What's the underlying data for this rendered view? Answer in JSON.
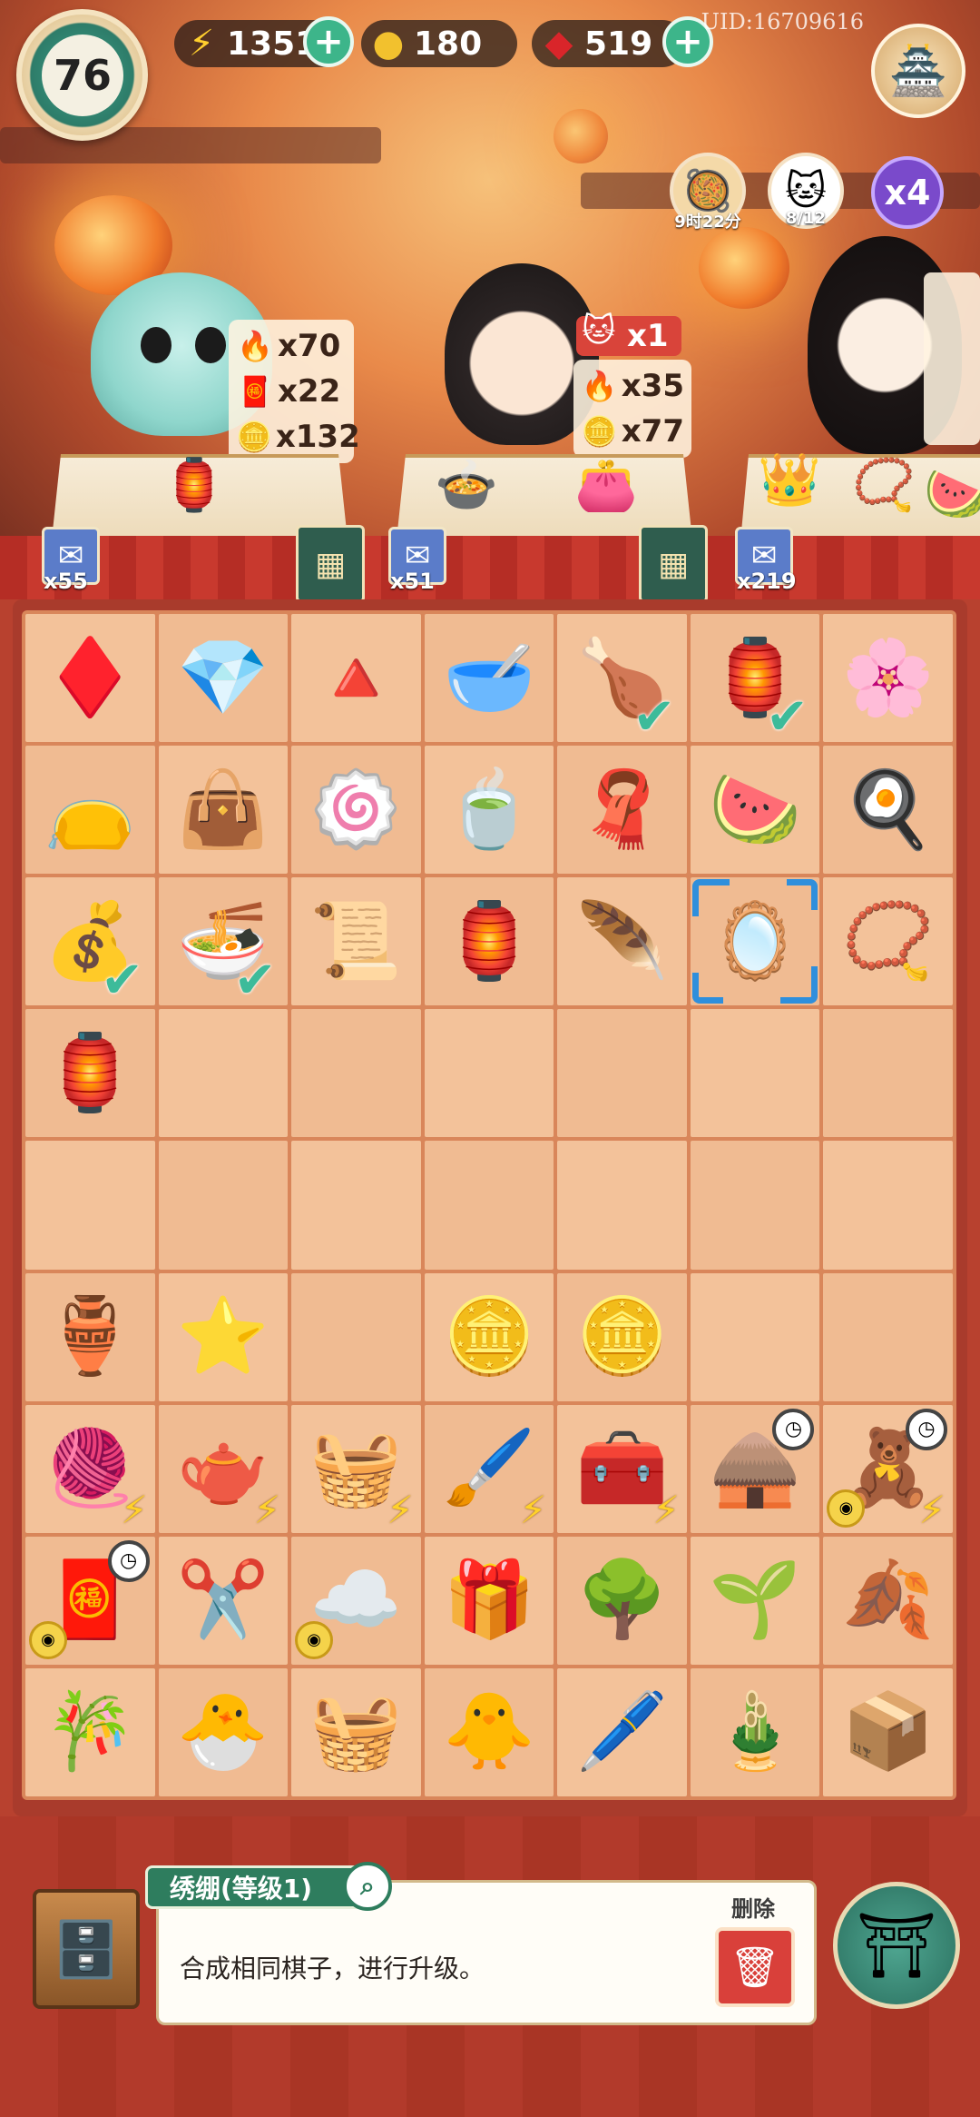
{
  "topbar": {
    "level": "76",
    "energy": "1351",
    "coins": "180",
    "gems": "519",
    "uid": "UID:16709616"
  },
  "status": {
    "timer_label": "9时22分",
    "cat_label": "8/12",
    "multiplier": "x4"
  },
  "customers": [
    {
      "rewards": [
        {
          "icon": "fire-orb-icon",
          "glyph": "🔥",
          "amount": "x70"
        },
        {
          "icon": "red-envelope-icon",
          "glyph": "🧧",
          "amount": "x22"
        },
        {
          "icon": "coin-icon",
          "glyph": "🪙",
          "amount": "x132"
        }
      ],
      "order_glyph": "🏮",
      "order_name": "lantern-order",
      "scroll_count": "x55"
    },
    {
      "want": "x1",
      "rewards": [
        {
          "icon": "fire-orb-icon",
          "glyph": "🔥",
          "amount": "x35"
        },
        {
          "icon": "coin-icon",
          "glyph": "🪙",
          "amount": "x77"
        }
      ],
      "order_glyph": "🍲",
      "order_name": "soup-order",
      "order2_glyph": "👛",
      "order2_name": "pouch-order",
      "scroll_count": "x51"
    },
    {
      "rewards": [],
      "order_glyph": "👑",
      "order_name": "crown-order",
      "order2_glyph": "📿",
      "order2_name": "bracelet-order",
      "scroll_count": "x219"
    }
  ],
  "board": [
    [
      {
        "g": "♦️",
        "n": "red-gem-1"
      },
      {
        "g": "💎",
        "n": "red-gem-2"
      },
      {
        "g": "🔺",
        "n": "red-gem-3"
      },
      {
        "g": "🥣",
        "n": "dumpling-soup"
      },
      {
        "g": "🍗",
        "n": "roast-chicken",
        "check": true
      },
      {
        "g": "🏮",
        "n": "palace-lantern",
        "check": true
      },
      {
        "g": "🌸",
        "n": "gold-hairpin"
      }
    ],
    [
      {
        "g": "👝",
        "n": "purple-pouch"
      },
      {
        "g": "👜",
        "n": "embroidered-bag"
      },
      {
        "g": "🍥",
        "n": "pink-cake"
      },
      {
        "g": "🍵",
        "n": "mung-bean-soup"
      },
      {
        "g": "🧣",
        "n": "blue-scarf"
      },
      {
        "g": "🍉",
        "n": "fruit-platter"
      },
      {
        "g": "🍳",
        "n": "fried-egg"
      }
    ],
    [
      {
        "g": "💰",
        "n": "small-pouch",
        "check": true
      },
      {
        "g": "🍜",
        "n": "chrysanthemum-bowl",
        "check": true
      },
      {
        "g": "📜",
        "n": "silk-scroll"
      },
      {
        "g": "🏮",
        "n": "paper-lantern"
      },
      {
        "g": "🪶",
        "n": "jade-feather"
      },
      {
        "g": "🪞",
        "n": "embroidery-hoop",
        "selected": true
      },
      {
        "g": "📿",
        "n": "gold-bracelet"
      }
    ],
    [
      {
        "g": "🏮",
        "n": "hanging-lantern"
      },
      {
        "g": "",
        "n": "empty"
      },
      {
        "g": "",
        "n": "empty"
      },
      {
        "g": "",
        "n": "empty"
      },
      {
        "g": "",
        "n": "empty"
      },
      {
        "g": "",
        "n": "empty"
      },
      {
        "g": "",
        "n": "empty"
      }
    ],
    [
      {
        "g": "",
        "n": "empty"
      },
      {
        "g": "",
        "n": "empty"
      },
      {
        "g": "",
        "n": "empty"
      },
      {
        "g": "",
        "n": "empty"
      },
      {
        "g": "",
        "n": "empty"
      },
      {
        "g": "",
        "n": "empty"
      },
      {
        "g": "",
        "n": "empty"
      }
    ],
    [
      {
        "g": "🏺",
        "n": "energy-gourd"
      },
      {
        "g": "⭐",
        "n": "star-gems"
      },
      {
        "g": "",
        "n": "empty"
      },
      {
        "g": "🪙",
        "n": "coin-single"
      },
      {
        "g": "🪙",
        "n": "coin-pair"
      },
      {
        "g": "",
        "n": "empty"
      },
      {
        "g": "",
        "n": "empty"
      }
    ],
    [
      {
        "g": "🧶",
        "n": "loom-generator",
        "bolt": true
      },
      {
        "g": "🫖",
        "n": "teapot-generator",
        "bolt": true
      },
      {
        "g": "🧺",
        "n": "food-box-generator",
        "bolt": true
      },
      {
        "g": "🖌️",
        "n": "brush-generator",
        "bolt": true
      },
      {
        "g": "🧰",
        "n": "jewel-chest-generator",
        "bolt": true
      },
      {
        "g": "🛖",
        "n": "chicken-coop-generator",
        "timer": true
      },
      {
        "g": "🧸",
        "n": "fortune-god-generator",
        "timer": true,
        "bolt": true,
        "coin": true
      }
    ],
    [
      {
        "g": "🧧",
        "n": "red-envelope-box",
        "timer": true,
        "coin": true
      },
      {
        "g": "✂️",
        "n": "scissors"
      },
      {
        "g": "☁️",
        "n": "cloud-jade",
        "coin": true
      },
      {
        "g": "🎁",
        "n": "gold-ingot-bag"
      },
      {
        "g": "🌳",
        "n": "coin-tree"
      },
      {
        "g": "🌱",
        "n": "gold-sprout"
      },
      {
        "g": "🍂",
        "n": "gold-leaves"
      }
    ],
    [
      {
        "g": "🎋",
        "n": "bamboo"
      },
      {
        "g": "🐣",
        "n": "chicks-nest-1"
      },
      {
        "g": "🧺",
        "n": "woven-basket"
      },
      {
        "g": "🐥",
        "n": "chicks-nest-2"
      },
      {
        "g": "🖊️",
        "n": "ruler-brush"
      },
      {
        "g": "🎍",
        "n": "bamboo-slips"
      },
      {
        "g": "📦",
        "n": "wooden-box"
      }
    ]
  ],
  "info": {
    "item_name": "绣绷(等级1)",
    "description": "合成相同棋子，进行升级。",
    "delete_label": "删除"
  }
}
